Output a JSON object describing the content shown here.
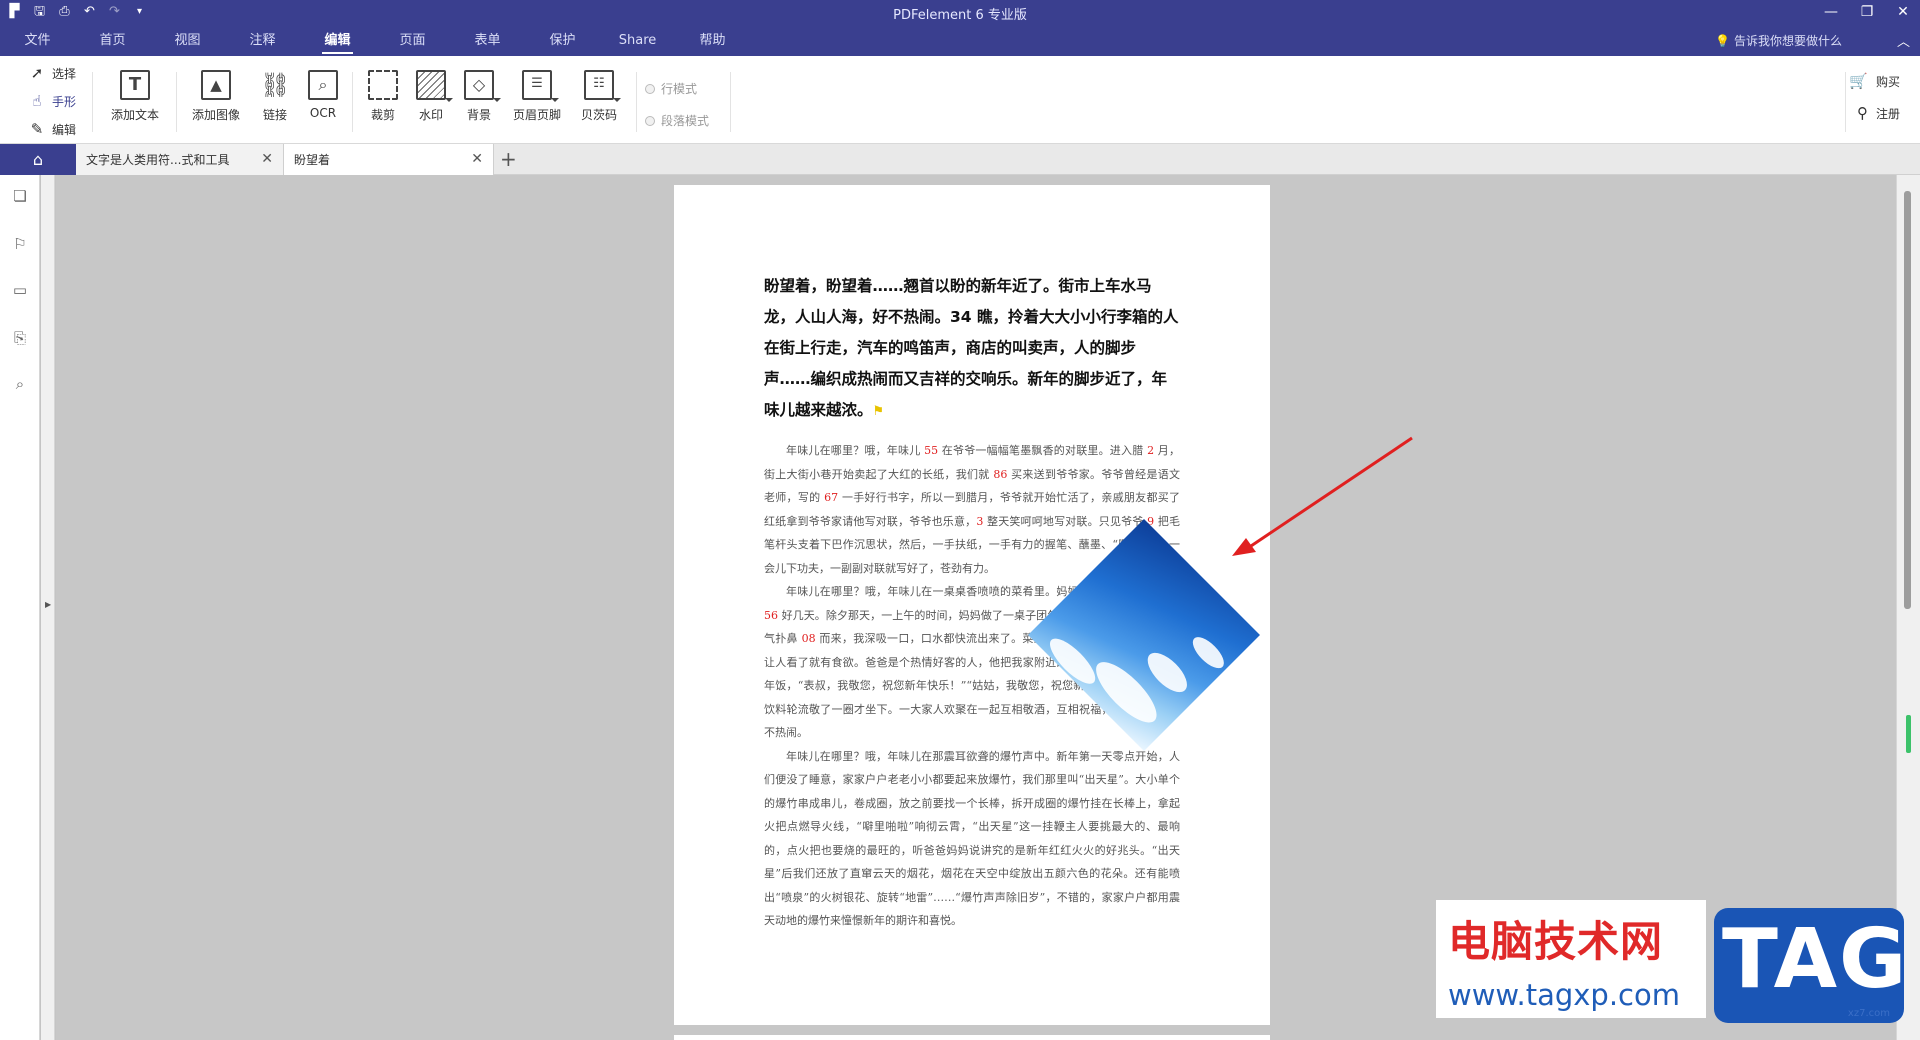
{
  "window": {
    "title": "PDFelement  6 专业版"
  },
  "menubar": {
    "items": [
      "文件",
      "首页",
      "视图",
      "注释",
      "编辑",
      "页面",
      "表单",
      "保护",
      "Share",
      "帮助"
    ],
    "active_index": 4,
    "tell_me": "告诉我你想要做什么"
  },
  "ribbon": {
    "modes": [
      {
        "label": "选择",
        "icon": "cursor-icon"
      },
      {
        "label": "手形",
        "icon": "hand-icon"
      },
      {
        "label": "编辑",
        "icon": "edit-icon"
      }
    ],
    "active_mode": 1,
    "tools": [
      {
        "label": "添加文本",
        "icon": "add-text-icon"
      },
      {
        "label": "添加图像",
        "icon": "add-image-icon"
      },
      {
        "label": "链接",
        "icon": "link-icon"
      },
      {
        "label": "OCR",
        "icon": "ocr-icon"
      },
      {
        "label": "裁剪",
        "icon": "crop-icon"
      },
      {
        "label": "水印",
        "icon": "watermark-icon"
      },
      {
        "label": "背景",
        "icon": "background-icon"
      },
      {
        "label": "页眉页脚",
        "icon": "header-footer-icon"
      },
      {
        "label": "贝茨码",
        "icon": "bates-icon"
      }
    ],
    "radio_options": [
      "行模式",
      "段落模式"
    ],
    "right_buttons": [
      {
        "label": "购买",
        "icon": "cart-icon"
      },
      {
        "label": "注册",
        "icon": "key-icon"
      }
    ]
  },
  "tabs": [
    {
      "label": "文字是人类用符...式和工具",
      "active": false
    },
    {
      "label": "盼望着",
      "active": true
    }
  ],
  "document": {
    "heading": "盼望着，盼望着……翘首以盼的新年近了。街市上车水马龙，人山人海，好不热闹。34 瞧，拎着大大小小行李箱的人在街上行走，汽车的鸣笛声，商店的叫卖声，人的脚步声……编织成热闹而又吉祥的交响乐。新年的脚步近了，年味儿越来越浓。",
    "paragraphs": [
      [
        {
          "t": "年味儿在哪里？哦，年味儿 "
        },
        {
          "t": "55",
          "red": true
        },
        {
          "t": " 在爷爷一幅幅笔墨飘香的对联里。进入腊 "
        },
        {
          "t": "2",
          "red": true
        },
        {
          "t": " 月，街上大街小巷开始卖起了大红的长纸，我们就 "
        },
        {
          "t": "86",
          "red": true
        },
        {
          "t": " 买来送到爷爷家。爷爷曾经是语文老师，写的 "
        },
        {
          "t": "67",
          "red": true
        },
        {
          "t": " 一手好行书字，所以一到腊月，爷爷就开始忙活了，亲戚朋友都买了红纸拿到爷爷家请他写对联，爷爷也乐意，"
        },
        {
          "t": "3",
          "red": true
        },
        {
          "t": " 整天笑呵呵地写对联。只见爷爷 "
        },
        {
          "t": "9",
          "red": true
        },
        {
          "t": " 把毛笔杆头支着下巴作沉思状，然后，一手扶纸，一手有力的握笔、蘸墨、“唰唰唰”，一会儿下功夫，一副副对联就写好了，苍劲有力。"
        }
      ],
      [
        {
          "t": "年味儿在哪里？哦，年味儿在一桌桌香喷喷的菜肴里。妈妈为了年的饭菜忙活了 "
        },
        {
          "t": "56",
          "red": true
        },
        {
          "t": " 好几天。除夕那天，一上午的时间，妈妈做了一桌子团年饭，饭桌上热气腾腾，香气扑鼻 "
        },
        {
          "t": "08",
          "red": true
        },
        {
          "t": " 而来，我深吸一口，口水都快流出来了。菜的颜色也经过妈妈细心搭配，让人看了就有食欲。爸爸是个热情好客的人，他把我家附近的亲戚全接到家里来吃团年饭，“表叔，我敬您，祝您新年快乐！”“姑姑，我敬您，祝您新年健康快乐！”我喝饮料轮流敬了一圈才坐下。一大家人欢聚在一起互相敬酒，互相祝福，其乐融融，好不热闹。"
        }
      ],
      [
        {
          "t": "年味儿在哪里？哦，年味儿在那震耳欲聋的爆竹声中。新年第一天零点开始，人们便没了睡意，家家户户老老小小都要起来放爆竹，我们那里叫“出天星”。大小单个的爆竹串成串儿，卷成圈，放之前要找一个长棒，拆开成圈的爆竹挂在长棒上，拿起火把点燃导火线，“噼里啪啦”响彻云霄，“出天星”这一挂鞭主人要挑最大的、最响的，点火把也要烧的最旺的，听爸爸妈妈说讲究的是新年红红火火的好兆头。“出天星”后我们还放了直窜云天的烟花，烟花在天空中绽放出五颜六色的花朵。还有能喷出“喷泉”的火树银花、旋转“地雷”……“爆竹声声除旧岁”，不错的，家家户户都用震天动地的爆竹来憧憬新年的期许和喜悦。"
        }
      ]
    ]
  },
  "watermark": {
    "line1": "电脑技术网",
    "line2": "www.tagxp.com",
    "badge": "TAG",
    "small": "xz7.com"
  },
  "colors": {
    "brand": "#3a3f8f",
    "highlight_red": "#e02020",
    "arrow": "#e02020"
  }
}
